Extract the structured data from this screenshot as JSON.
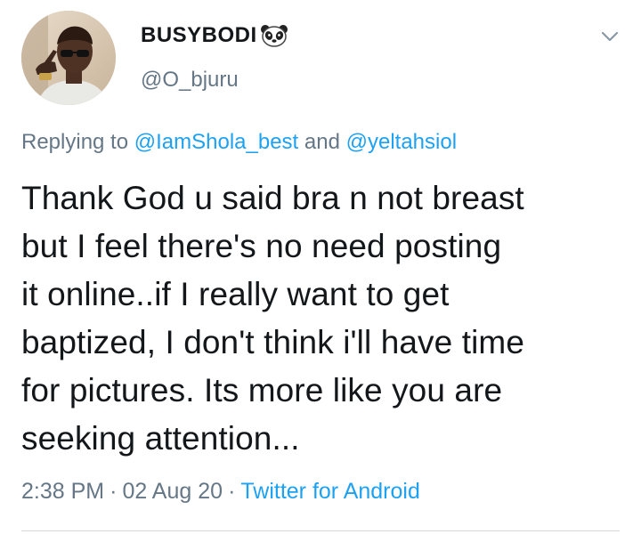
{
  "tweet": {
    "author": {
      "name": "BUSYBODI",
      "name_emoji": "panda-face-icon",
      "handle": "@O_bjuru",
      "avatar": "user-avatar-photo"
    },
    "menu_icon": "chevron-down-icon",
    "reply": {
      "prefix": "Replying to",
      "mention_1": "@IamShola_best",
      "conjunction": "and",
      "mention_2": "@yeltahsiol"
    },
    "text_lines": [
      "Thank God u said bra n not breast",
      "but I feel there's no need posting",
      "it online..if I really want to get",
      "baptized, I don't think i'll have time",
      "for pictures. Its more like you are",
      "seeking attention..."
    ],
    "meta": {
      "time": "2:38 PM",
      "separator": "·",
      "date": "02 Aug 20",
      "source": "Twitter for Android"
    },
    "colors": {
      "text": "#14171a",
      "secondary": "#657786",
      "link": "#1da1f2",
      "divider": "#d6d9dc"
    }
  }
}
